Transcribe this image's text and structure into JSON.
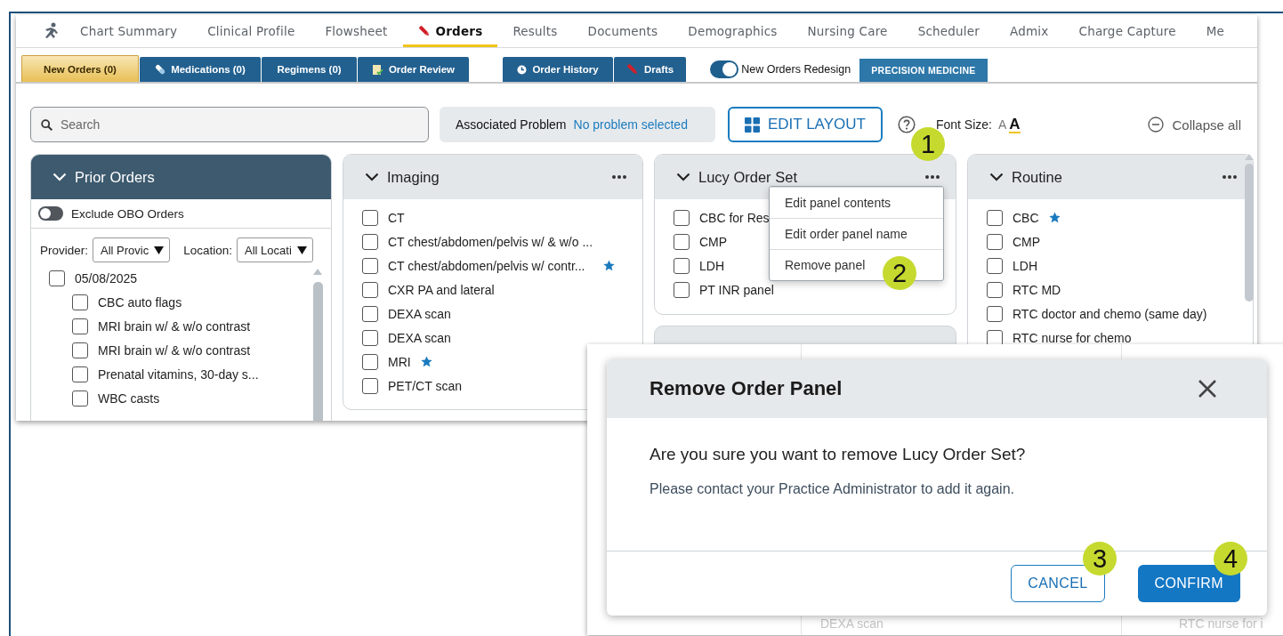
{
  "nav": {
    "tabs": [
      {
        "label": "Chart Summary",
        "selected": false
      },
      {
        "label": "Clinical Profile",
        "selected": false
      },
      {
        "label": "Flowsheet",
        "selected": false
      },
      {
        "label": "Orders",
        "selected": true
      },
      {
        "label": "Results",
        "selected": false
      },
      {
        "label": "Documents",
        "selected": false
      },
      {
        "label": "Demographics",
        "selected": false
      },
      {
        "label": "Nursing Care",
        "selected": false
      },
      {
        "label": "Scheduler",
        "selected": false
      },
      {
        "label": "Admix",
        "selected": false
      },
      {
        "label": "Charge Capture",
        "selected": false
      },
      {
        "label": "Me",
        "selected": false
      }
    ]
  },
  "subtabs": [
    {
      "label": "New Orders (0)",
      "selected": true
    },
    {
      "label": "Medications (0)",
      "selected": false
    },
    {
      "label": "Regimens (0)",
      "selected": false
    },
    {
      "label": "Order Review",
      "selected": false
    },
    {
      "label": "Order History",
      "selected": false
    },
    {
      "label": "Drafts",
      "selected": false
    }
  ],
  "redesign_toggle": {
    "label": "New Orders Redesign",
    "on": true
  },
  "precision_button": "PRECISION MEDICINE",
  "toolbar": {
    "search": {
      "placeholder": "Search"
    },
    "associated_problem": {
      "label": "Associated Problem",
      "value": "No problem selected"
    },
    "edit_layout": "EDIT LAYOUT",
    "font_size": {
      "label": "Font Size:",
      "small": "A",
      "large": "A"
    },
    "collapse_all": "Collapse all"
  },
  "prior_orders": {
    "title": "Prior Orders",
    "exclude_obo": {
      "label": "Exclude OBO Orders",
      "on": false
    },
    "provider": {
      "label": "Provider:",
      "value": "All Provic"
    },
    "location": {
      "label": "Location:",
      "value": "All Locati"
    },
    "groups": [
      {
        "label": "05/08/2025",
        "checked": false,
        "children": [
          {
            "label": "CBC auto flags",
            "checked": false
          },
          {
            "label": "MRI brain w/ & w/o contrast",
            "checked": false
          },
          {
            "label": "MRI brain w/ & w/o contrast",
            "checked": false
          },
          {
            "label": "Prenatal vitamins, 30-day s...",
            "checked": false
          },
          {
            "label": "WBC casts",
            "checked": false
          }
        ]
      }
    ]
  },
  "panels": [
    {
      "title": "Imaging",
      "items": [
        {
          "label": "CT",
          "checked": false,
          "starred": false
        },
        {
          "label": "CT chest/abdomen/pelvis w/ & w/o ...",
          "checked": false,
          "starred": false
        },
        {
          "label": "CT chest/abdomen/pelvis w/ contr...",
          "checked": false,
          "starred": true
        },
        {
          "label": "CXR PA and lateral",
          "checked": false,
          "starred": false
        },
        {
          "label": "DEXA scan",
          "checked": false,
          "starred": false
        },
        {
          "label": "DEXA scan",
          "checked": false,
          "starred": false
        },
        {
          "label": "MRI",
          "checked": false,
          "starred": true
        },
        {
          "label": "PET/CT scan",
          "checked": false,
          "starred": false
        }
      ]
    },
    {
      "title": "Lucy Order Set",
      "items": [
        {
          "label": "CBC for Res",
          "checked": false,
          "starred": false
        },
        {
          "label": "CMP",
          "checked": false,
          "starred": false
        },
        {
          "label": "LDH",
          "checked": false,
          "starred": false
        },
        {
          "label": "PT INR panel",
          "checked": false,
          "starred": false
        }
      ]
    },
    {
      "title": "Routine",
      "items": [
        {
          "label": "CBC",
          "checked": false,
          "starred": true
        },
        {
          "label": "CMP",
          "checked": false,
          "starred": false
        },
        {
          "label": "LDH",
          "checked": false,
          "starred": false
        },
        {
          "label": "RTC MD",
          "checked": false,
          "starred": false
        },
        {
          "label": "RTC doctor and chemo (same day)",
          "checked": false,
          "starred": false
        },
        {
          "label": "RTC nurse for chemo",
          "checked": false,
          "starred": false
        }
      ]
    }
  ],
  "panel_menu": {
    "items": [
      "Edit panel contents",
      "Edit order panel name",
      "Remove panel"
    ]
  },
  "background_remnants": [
    "DEXA scan",
    "RTC nurse for i"
  ],
  "dialog": {
    "title": "Remove Order Panel",
    "question": "Are you sure you want to remove Lucy Order Set?",
    "note": "Please contact your Practice Administrator to add it again.",
    "buttons": [
      {
        "label": "CANCEL",
        "kind": "secondary"
      },
      {
        "label": "CONFIRM",
        "kind": "primary"
      }
    ]
  },
  "callouts": [
    "1",
    "2",
    "3",
    "4"
  ]
}
